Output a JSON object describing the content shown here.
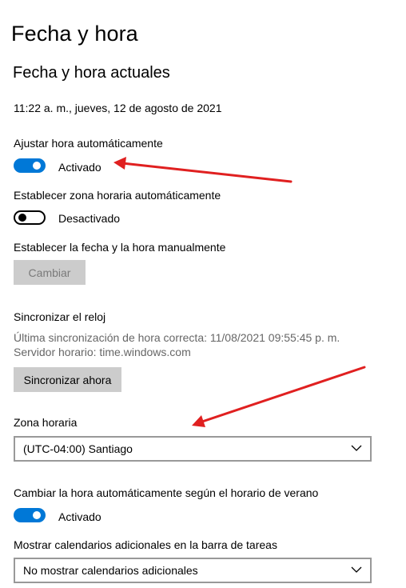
{
  "page": {
    "title": "Fecha y hora",
    "section_title": "Fecha y hora actuales",
    "current_datetime": "11:22 a. m., jueves, 12 de agosto de 2021"
  },
  "auto_time": {
    "label": "Ajustar hora automáticamente",
    "state": "Activado",
    "on": true
  },
  "auto_timezone": {
    "label": "Establecer zona horaria automáticamente",
    "state": "Desactivado",
    "on": false
  },
  "manual": {
    "label": "Establecer la fecha y la hora manualmente",
    "button": "Cambiar"
  },
  "sync": {
    "title": "Sincronizar el reloj",
    "last_sync": "Última sincronización de hora correcta: 11/08/2021 09:55:45 p. m.",
    "server": "Servidor horario: time.windows.com",
    "button": "Sincronizar ahora"
  },
  "timezone": {
    "label": "Zona horaria",
    "value": "(UTC-04:00) Santiago"
  },
  "dst": {
    "label": "Cambiar la hora automáticamente según el horario de verano",
    "state": "Activado",
    "on": true
  },
  "calendars": {
    "label": "Mostrar calendarios adicionales en la barra de tareas",
    "value": "No mostrar calendarios adicionales"
  },
  "colors": {
    "accent": "#0078d7",
    "annotation_arrow": "#e02020"
  },
  "icons": {
    "dropdown": "chevron-down-icon"
  }
}
